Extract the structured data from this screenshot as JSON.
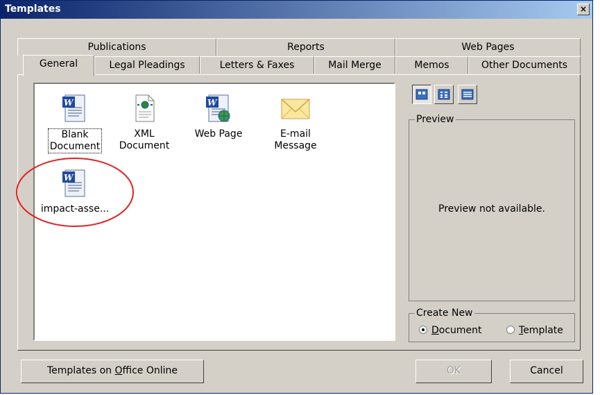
{
  "window": {
    "title": "Templates",
    "close_glyph": "×"
  },
  "tabs": {
    "row1": [
      {
        "label": "Publications"
      },
      {
        "label": "Reports"
      },
      {
        "label": "Web Pages"
      }
    ],
    "row2": [
      {
        "label": "General",
        "active": true
      },
      {
        "label": "Legal Pleadings"
      },
      {
        "label": "Letters & Faxes"
      },
      {
        "label": "Mail Merge"
      },
      {
        "label": "Memos"
      },
      {
        "label": "Other Documents"
      }
    ]
  },
  "templates": [
    {
      "label_line1": "Blank",
      "label_line2": "Document",
      "icon": "word-document-icon",
      "selected": true
    },
    {
      "label_line1": "XML Document",
      "label_line2": "",
      "icon": "xml-document-icon"
    },
    {
      "label_line1": "Web Page",
      "label_line2": "",
      "icon": "web-page-icon"
    },
    {
      "label_line1": "E-mail",
      "label_line2": "Message",
      "icon": "email-message-icon"
    },
    {
      "label_line1": "impact-asse...",
      "label_line2": "",
      "icon": "word-document-icon",
      "highlighted": true
    }
  ],
  "preview": {
    "legend": "Preview",
    "message": "Preview not available."
  },
  "create_new": {
    "legend": "Create New",
    "options": [
      {
        "accel": "D",
        "rest": "ocument",
        "selected": true
      },
      {
        "accel": "T",
        "rest": "emplate",
        "selected": false
      }
    ]
  },
  "buttons": {
    "online_before": "Templates on ",
    "online_accel": "O",
    "online_after": "ffice Online",
    "ok": "OK",
    "cancel": "Cancel"
  },
  "colors": {
    "titlebar_start": "#0a246a",
    "titlebar_end": "#a6caf0",
    "face": "#d4d0c8",
    "highlight_circle": "#e02020"
  }
}
